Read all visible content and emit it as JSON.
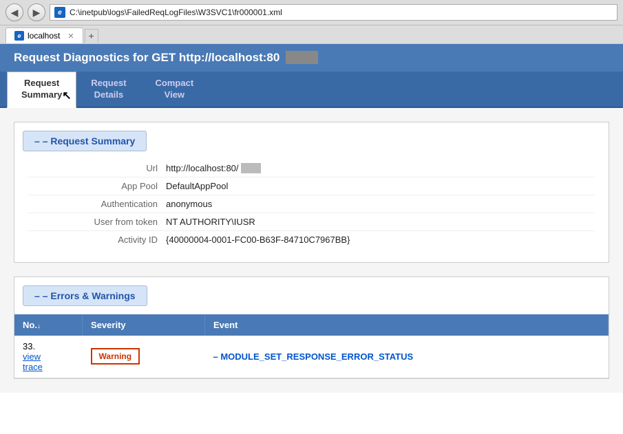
{
  "browser": {
    "back_icon": "◀",
    "forward_icon": "▶",
    "address": "C:\\inetpub\\logs\\FailedReqLogFiles\\W3SVC1\\fr000001.xml",
    "tab_label": "localhost",
    "tab_close": "✕",
    "new_tab_icon": "+"
  },
  "page": {
    "header_title": "Request Diagnostics for GET http://localhost:80",
    "header_title_hidden": "...",
    "tabs": [
      {
        "id": "request-summary",
        "label": "Request\nSummary",
        "active": true
      },
      {
        "id": "request-details",
        "label": "Request\nDetails",
        "active": false
      },
      {
        "id": "compact-view",
        "label": "Compact\nView",
        "active": false
      }
    ],
    "request_summary": {
      "section_label": "– Request Summary",
      "fields": [
        {
          "label": "Url",
          "value": "http://localhost:80/"
        },
        {
          "label": "App Pool",
          "value": "DefaultAppPool"
        },
        {
          "label": "Authentication",
          "value": "anonymous"
        },
        {
          "label": "User from token",
          "value": "NT AUTHORITY\\IUSR"
        },
        {
          "label": "Activity ID",
          "value": "{40000004-0001-FC00-B63F-84710C7967BB}"
        }
      ]
    },
    "errors_warnings": {
      "section_label": "– Errors & Warnings",
      "table": {
        "columns": [
          {
            "label": "No.↓",
            "sort": true
          },
          {
            "label": "Severity"
          },
          {
            "label": "Event"
          }
        ],
        "rows": [
          {
            "no": "33.",
            "no_link": "view\ntrace",
            "severity": "Warning",
            "event": "– MODULE_SET_RESPONSE_ERROR_STATUS"
          }
        ]
      }
    }
  }
}
